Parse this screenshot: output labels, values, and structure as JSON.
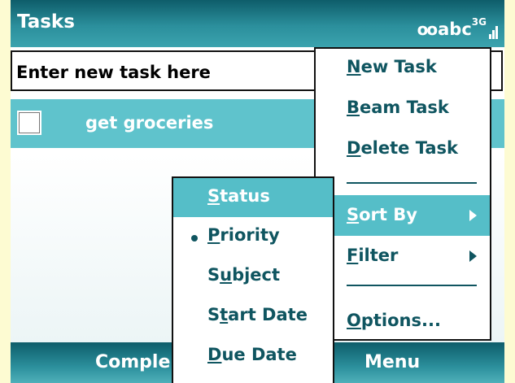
{
  "header": {
    "title": "Tasks",
    "status": {
      "roaming_icon": "roaming-icon",
      "abc": "abc",
      "network": "3G",
      "signal_icon": "signal-strength-icon"
    }
  },
  "task_input": {
    "placeholder": "Enter new task here"
  },
  "tasks": [
    {
      "label": "get groceries",
      "checked": false,
      "selected": true
    }
  ],
  "softkeys": {
    "left": "Comple",
    "right": "Menu"
  },
  "menu": {
    "items": [
      {
        "pre": "",
        "hk": "N",
        "post": "ew Task"
      },
      {
        "pre": "",
        "hk": "B",
        "post": "eam Task"
      },
      {
        "pre": "",
        "hk": "D",
        "post": "elete Task"
      },
      {
        "pre": "",
        "hk": "S",
        "post": "ort By"
      },
      {
        "pre": "",
        "hk": "F",
        "post": "ilter"
      },
      {
        "pre": "",
        "hk": "O",
        "post": "ptions..."
      }
    ],
    "selected": "Sort By"
  },
  "sort_menu": {
    "items": [
      {
        "pre": "",
        "hk": "S",
        "post": "tatus"
      },
      {
        "pre": "",
        "hk": "P",
        "post": "riority"
      },
      {
        "pre": "S",
        "hk": "u",
        "post": "bject"
      },
      {
        "pre": "S",
        "hk": "t",
        "post": "art Date"
      },
      {
        "pre": "",
        "hk": "D",
        "post": "ue Date"
      }
    ],
    "highlighted": "Status",
    "checked": "Priority"
  },
  "colors": {
    "titlebar": "#1f7f8c",
    "accent": "#55bec8",
    "menu_text": "#0f5560",
    "background": "#fdfbd2"
  }
}
